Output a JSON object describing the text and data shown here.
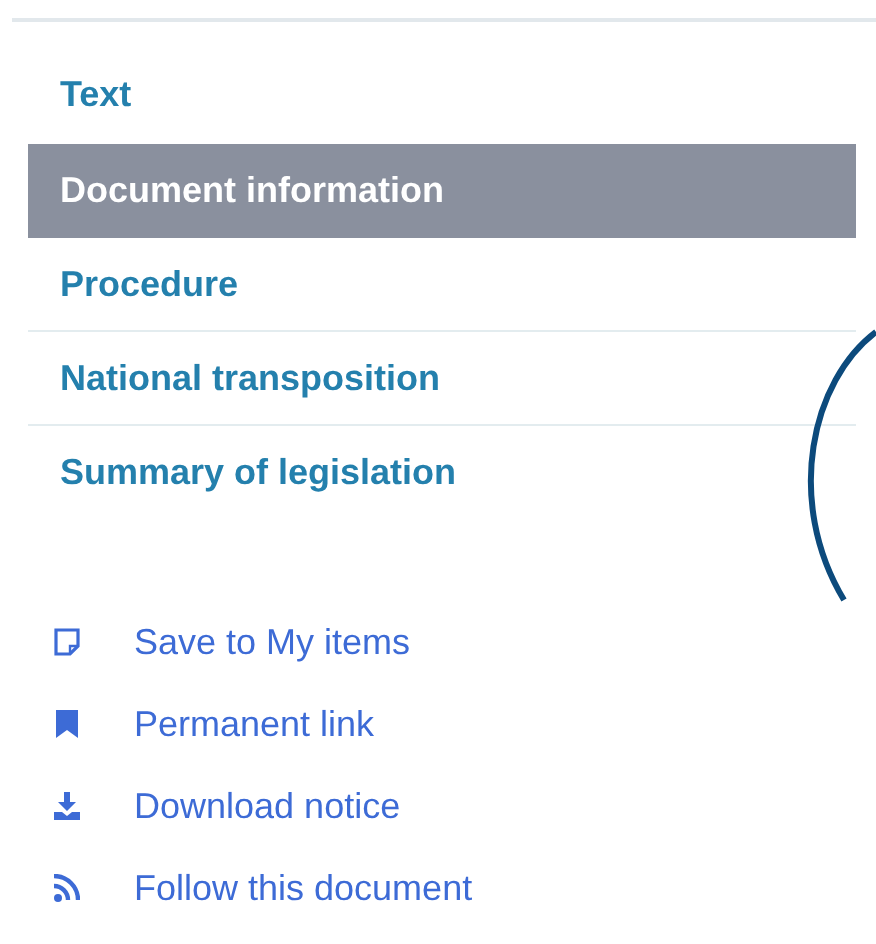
{
  "nav": [
    {
      "label": "Text",
      "selected": false
    },
    {
      "label": "Document information",
      "selected": true
    },
    {
      "label": "Procedure",
      "selected": false
    },
    {
      "label": "National transposition",
      "selected": false
    },
    {
      "label": "Summary of legislation",
      "selected": false
    }
  ],
  "actions": [
    {
      "label": "Save to My items",
      "kind": "save"
    },
    {
      "label": "Permanent link",
      "kind": "bookmark"
    },
    {
      "label": "Download notice",
      "kind": "download"
    },
    {
      "label": "Follow this document",
      "kind": "rss"
    }
  ]
}
